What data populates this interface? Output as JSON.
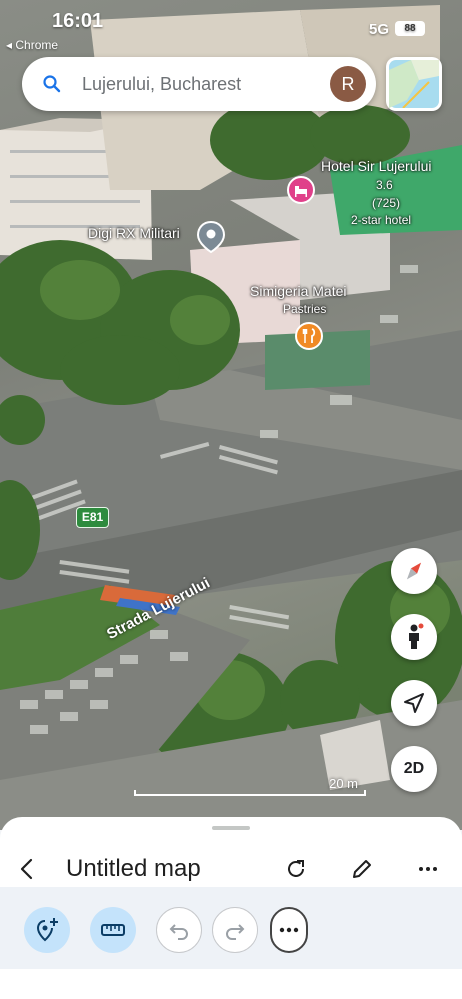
{
  "status_bar": {
    "time": "16:01",
    "back_app": "◂ Chrome",
    "signal": "5G",
    "battery": "88"
  },
  "search": {
    "query": "Lujerului, Bucharest",
    "avatar_letter": "R"
  },
  "map": {
    "places": [
      {
        "name": "Hotel Sir Lujerului",
        "rating": "3.6",
        "reviews": "(725)",
        "category": "2-star hotel"
      },
      {
        "name": "Digi RX Militari"
      },
      {
        "name": "Simigeria Matei",
        "category": "Pastries"
      }
    ],
    "route_shield": "E81",
    "street_name": "Strada Lujerului",
    "scale_label": "20 m",
    "view_mode_button": "2D"
  },
  "sheet": {
    "title": "Untitled map"
  },
  "icons": {
    "search": "search-icon",
    "compass": "compass-icon",
    "pegman": "street-view-icon",
    "locate": "my-location-icon",
    "back": "back-arrow-icon",
    "refresh": "refresh-icon",
    "edit": "pencil-icon",
    "more": "more-horizontal-icon",
    "add_pin": "add-pin-icon",
    "measure": "ruler-icon",
    "undo": "undo-icon",
    "redo": "redo-icon"
  },
  "colors": {
    "accent_blue": "#1a73e8",
    "active_tool_bg": "#c4e3fb",
    "hotel_pin": "#e0408a",
    "food_pin": "#f08a24",
    "route_green": "#2e8b3e"
  }
}
